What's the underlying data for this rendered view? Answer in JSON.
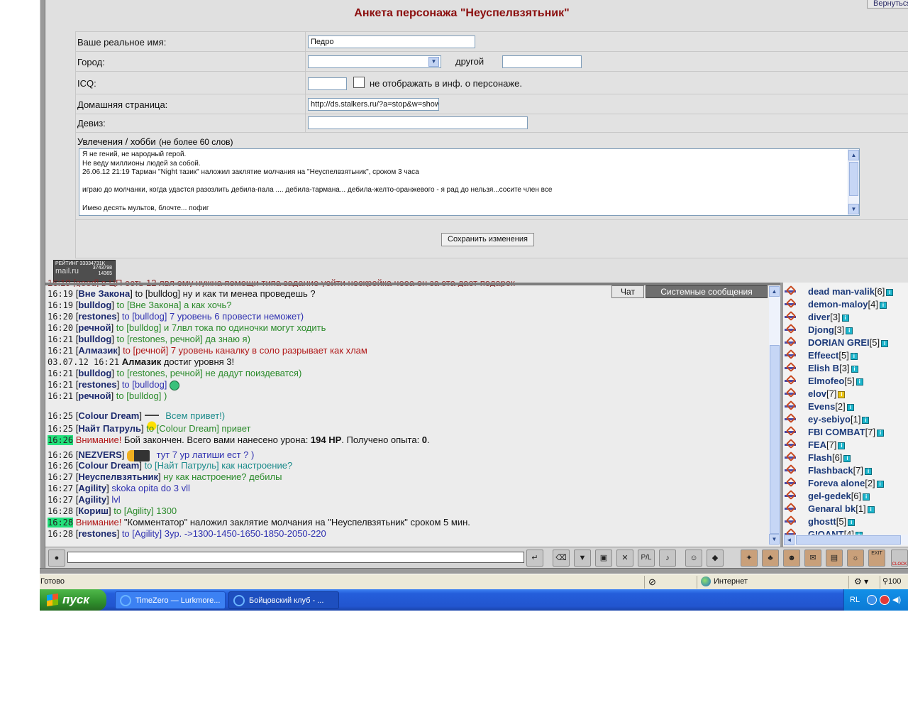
{
  "form": {
    "back_label": "Вернуться",
    "title": "Анкета персонажа \"Неуспелвзятьник\"",
    "real_name_label": "Ваше реальное имя:",
    "real_name_value": "Педро",
    "city_label": "Город:",
    "city_value": "",
    "city_other_label": "другой",
    "city_other_value": "",
    "icq_label": "ICQ:",
    "icq_value": "",
    "icq_hide_label": "не отображать в инф. о персонаже.",
    "homepage_label": "Домашняя страница:",
    "homepage_value": "http://ds.stalkers.ru/?a=stop&w=show",
    "motto_label": "Девиз:",
    "motto_value": "",
    "hobby_label": "Увлечения / хобби",
    "hobby_note": "(не более 60 слов)",
    "hobby_lines": [
      "Я не гений, не народный герой.",
      "Не веду миллионы людей за собой.",
      "26.06.12 21:19  Тарман \"Night тазик\" наложил заклятие молчания на \"Неуспелвзятьник\", сроком 3 часа",
      "",
      "играю до молчанки, когда удастся разозлить дебила-пала .... дебила-тармана... дебила-желто-оранжевого  - я рад до нельзя...сосите член все",
      "",
      "Имею десять мультов, блочте... пофиг"
    ],
    "save_label": "Сохранить изменения"
  },
  "rating": {
    "line1": "РЕЙТИНГ 33334731K",
    "brand": "mail.ru",
    "n1": "3743798",
    "n2": "14365"
  },
  "chat": {
    "tabs": {
      "chat": "Чат",
      "system": "Системные сообщения"
    },
    "top_partial": "16:19 [good] в ЦП есть 12 лвл ему нужна помощи типа задание уойти нескройка чеоа он за эта дает подарок",
    "messages": [
      {
        "time": "16:19",
        "nick": "Вне Закона",
        "pre": "to [bulldog]",
        "text": " ну и как ти менеа проведешь ?",
        "color": "plain"
      },
      {
        "time": "16:19",
        "nick": "bulldog",
        "pre": "to [Вне Закона]",
        "text": " а как хочь?",
        "color": "grn"
      },
      {
        "time": "16:20",
        "nick": "restones",
        "pre": "to [bulldog]",
        "text": " 7 уровень 6 провести неможет)",
        "color": "blu"
      },
      {
        "time": "16:20",
        "nick": "речной",
        "pre": "to [bulldog]",
        "text": " и 7лвл тока по одиночки могут ходить",
        "color": "grn"
      },
      {
        "time": "16:21",
        "nick": "bulldog",
        "pre": "to [restones, речной]",
        "text": " да знаю я)",
        "color": "grn"
      },
      {
        "time": "16:21",
        "nick": "Алмазик",
        "pre": "to [речной]",
        "text": " 7 уровень каналку в соло разрывает как хлам",
        "color": "red"
      },
      {
        "time": "03.07.12 16:21",
        "nick": "Алмазик",
        "pre": "",
        "text": " достиг уровня 3!",
        "color": "system"
      },
      {
        "time": "16:21",
        "nick": "bulldog",
        "pre": "to [restones, речной]",
        "text": " не дадут поиздеватся)",
        "color": "grn"
      },
      {
        "time": "16:21",
        "nick": "restones",
        "pre": "to [bulldog]",
        "text": "",
        "color": "blu",
        "emoji": "smile"
      },
      {
        "time": "16:21",
        "nick": "речной",
        "pre": "to [bulldog]",
        "text": " )",
        "color": "grn"
      },
      {
        "time": "16:25",
        "nick": "Colour Dream",
        "pre": "",
        "text": " Всем привет!)",
        "color": "teal",
        "emoji": "wave"
      },
      {
        "time": "16:25",
        "nick": "Найт Патруль",
        "pre": "to [Colour Dream]",
        "text": " привет",
        "color": "grn"
      },
      {
        "time": "16:26",
        "highlight": true,
        "warning": "Внимание!",
        "system_text": " Бой закончен. Всего вами нанесено урона: ",
        "dmg": "194 HP",
        "mid": ". Получено опыта: ",
        "xp": "0",
        "end": "."
      },
      {
        "time": "16:26",
        "nick": "NEZVERS",
        "pre": "",
        "text": " тут 7 ур латиши ест ? )",
        "color": "blu",
        "emoji": "gun"
      },
      {
        "time": "16:26",
        "nick": "Colour Dream",
        "pre": "to [Найт Патруль]",
        "text": " как настроение?",
        "color": "teal"
      },
      {
        "time": "16:27",
        "nick": "Неуспелвзятьник",
        "pre": "",
        "text": " ну как настроение? дебилы",
        "color": "grn"
      },
      {
        "time": "16:27",
        "nick": "Agility",
        "pre": "",
        "text": " skoka opita do 3 vll",
        "color": "blu"
      },
      {
        "time": "16:27",
        "nick": "Agility",
        "pre": "",
        "text": " lvl",
        "color": "blu"
      },
      {
        "time": "16:28",
        "nick": "Кориш",
        "pre": "to [Agility]",
        "text": " 1300",
        "color": "grn"
      },
      {
        "time": "16:28",
        "highlight": true,
        "warning": "Внимание!",
        "system_text": " \"Комментатор\" наложил заклятие молчания на \"Неуспелвзятьник\" сроком 5 мин."
      },
      {
        "time": "16:28",
        "nick": "restones",
        "pre": "to [Agility]",
        "text": " 3ур. ->1300-1450-1650-1850-2050-220",
        "color": "blu"
      }
    ],
    "input_value": ""
  },
  "users": [
    {
      "name": "dead man-valik",
      "level": "[6]"
    },
    {
      "name": "demon-maloy",
      "level": "[4]"
    },
    {
      "name": "diver",
      "level": "[3]"
    },
    {
      "name": "Djong",
      "level": "[3]"
    },
    {
      "name": "DORIAN GREI",
      "level": "[5]"
    },
    {
      "name": "Effeect",
      "level": "[5]"
    },
    {
      "name": "Elish B",
      "level": "[3]"
    },
    {
      "name": "Elmofeo",
      "level": "[5]"
    },
    {
      "name": "elov",
      "level": "[7]"
    },
    {
      "name": "Evens",
      "level": "[2]"
    },
    {
      "name": "ey-sebiyo",
      "level": "[1]"
    },
    {
      "name": "FBI COMBAT",
      "level": "[7]"
    },
    {
      "name": "FEA",
      "level": "[7]"
    },
    {
      "name": "Flash",
      "level": "[6]"
    },
    {
      "name": "Flashback",
      "level": "[7]"
    },
    {
      "name": "Foreva alone",
      "level": "[2]"
    },
    {
      "name": "gel-gedek",
      "level": "[6]"
    },
    {
      "name": "Genaral bk",
      "level": "[1]"
    },
    {
      "name": "ghostt",
      "level": "[5]"
    },
    {
      "name": "GIOANT",
      "level": "[4]"
    }
  ],
  "toolbar": {
    "exit_label": "EXIT",
    "clock_label": "CLOCK"
  },
  "statusbar": {
    "status": "Готово",
    "zone": "Интернет",
    "zoom": "100"
  },
  "taskbar": {
    "start": "пуск",
    "tasks": [
      "TimeZero — Lurkmore...",
      "Бойцовский клуб - ..."
    ],
    "lang": "RL"
  },
  "colors": {
    "title": "#8b0e0e",
    "nick": "#1c2a6e",
    "green_text": "#2a8a2a",
    "blue_text": "#2e30b0",
    "warning": "#b01818",
    "highlight": "#21e07a"
  }
}
